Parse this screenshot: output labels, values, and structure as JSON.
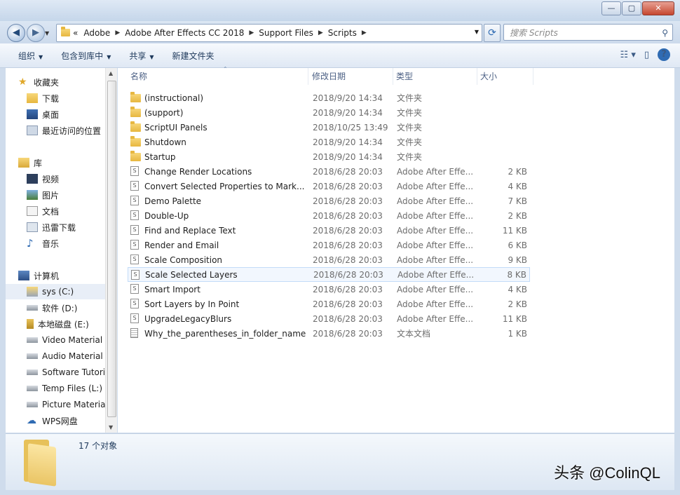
{
  "window": {
    "minimize": "—",
    "maximize": "▢",
    "close": "✕"
  },
  "nav": {
    "back": "◀",
    "forward": "▶"
  },
  "address": {
    "prefix": "«",
    "crumbs": [
      "Adobe",
      "Adobe After Effects CC 2018",
      "Support Files",
      "Scripts"
    ]
  },
  "search": {
    "placeholder": "搜索 Scripts"
  },
  "toolbar": {
    "organize": "组织",
    "include_in_library": "包含到库中",
    "share": "共享",
    "new_folder": "新建文件夹"
  },
  "sidebar": {
    "favorites": "收藏夹",
    "downloads": "下载",
    "desktop": "桌面",
    "recent": "最近访问的位置",
    "libraries": "库",
    "videos": "视频",
    "pictures": "图片",
    "documents": "文档",
    "xunlei": "迅雷下载",
    "music": "音乐",
    "computer": "计算机",
    "drives": [
      "sys (C:)",
      "软件 (D:)",
      "本地磁盘 (E:)",
      "Video Material",
      "Audio Material",
      "Software Tutori",
      "Temp Files (L:)",
      "Picture Materia",
      "WPS网盘"
    ]
  },
  "columns": {
    "name": "名称",
    "date": "修改日期",
    "type": "类型",
    "size": "大小"
  },
  "files": [
    {
      "name": "(instructional)",
      "date": "2018/9/20 14:34",
      "type": "文件夹",
      "size": "",
      "kind": "folder"
    },
    {
      "name": "(support)",
      "date": "2018/9/20 14:34",
      "type": "文件夹",
      "size": "",
      "kind": "folder"
    },
    {
      "name": "ScriptUI Panels",
      "date": "2018/10/25 13:49",
      "type": "文件夹",
      "size": "",
      "kind": "folder"
    },
    {
      "name": "Shutdown",
      "date": "2018/9/20 14:34",
      "type": "文件夹",
      "size": "",
      "kind": "folder"
    },
    {
      "name": "Startup",
      "date": "2018/9/20 14:34",
      "type": "文件夹",
      "size": "",
      "kind": "folder"
    },
    {
      "name": "Change Render Locations",
      "date": "2018/6/28 20:03",
      "type": "Adobe After Effe...",
      "size": "2 KB",
      "kind": "script"
    },
    {
      "name": "Convert Selected Properties to Mark...",
      "date": "2018/6/28 20:03",
      "type": "Adobe After Effe...",
      "size": "4 KB",
      "kind": "script"
    },
    {
      "name": "Demo Palette",
      "date": "2018/6/28 20:03",
      "type": "Adobe After Effe...",
      "size": "7 KB",
      "kind": "script"
    },
    {
      "name": "Double-Up",
      "date": "2018/6/28 20:03",
      "type": "Adobe After Effe...",
      "size": "2 KB",
      "kind": "script"
    },
    {
      "name": "Find and Replace Text",
      "date": "2018/6/28 20:03",
      "type": "Adobe After Effe...",
      "size": "11 KB",
      "kind": "script"
    },
    {
      "name": "Render and Email",
      "date": "2018/6/28 20:03",
      "type": "Adobe After Effe...",
      "size": "6 KB",
      "kind": "script"
    },
    {
      "name": "Scale Composition",
      "date": "2018/6/28 20:03",
      "type": "Adobe After Effe...",
      "size": "9 KB",
      "kind": "script"
    },
    {
      "name": "Scale Selected Layers",
      "date": "2018/6/28 20:03",
      "type": "Adobe After Effe...",
      "size": "8 KB",
      "kind": "script",
      "highlighted": true
    },
    {
      "name": "Smart Import",
      "date": "2018/6/28 20:03",
      "type": "Adobe After Effe...",
      "size": "4 KB",
      "kind": "script"
    },
    {
      "name": "Sort Layers by In Point",
      "date": "2018/6/28 20:03",
      "type": "Adobe After Effe...",
      "size": "2 KB",
      "kind": "script"
    },
    {
      "name": "UpgradeLegacyBlurs",
      "date": "2018/6/28 20:03",
      "type": "Adobe After Effe...",
      "size": "11 KB",
      "kind": "script"
    },
    {
      "name": "Why_the_parentheses_in_folder_names",
      "date": "2018/6/28 20:03",
      "type": "文本文档",
      "size": "1 KB",
      "kind": "text"
    }
  ],
  "status": {
    "item_count": "17 个对象"
  },
  "watermark": "头条 @ColinQL",
  "colors": {
    "accent": "#2f6bb3",
    "folder": "#e7b740",
    "highlight_row": "#f2f7fe"
  }
}
